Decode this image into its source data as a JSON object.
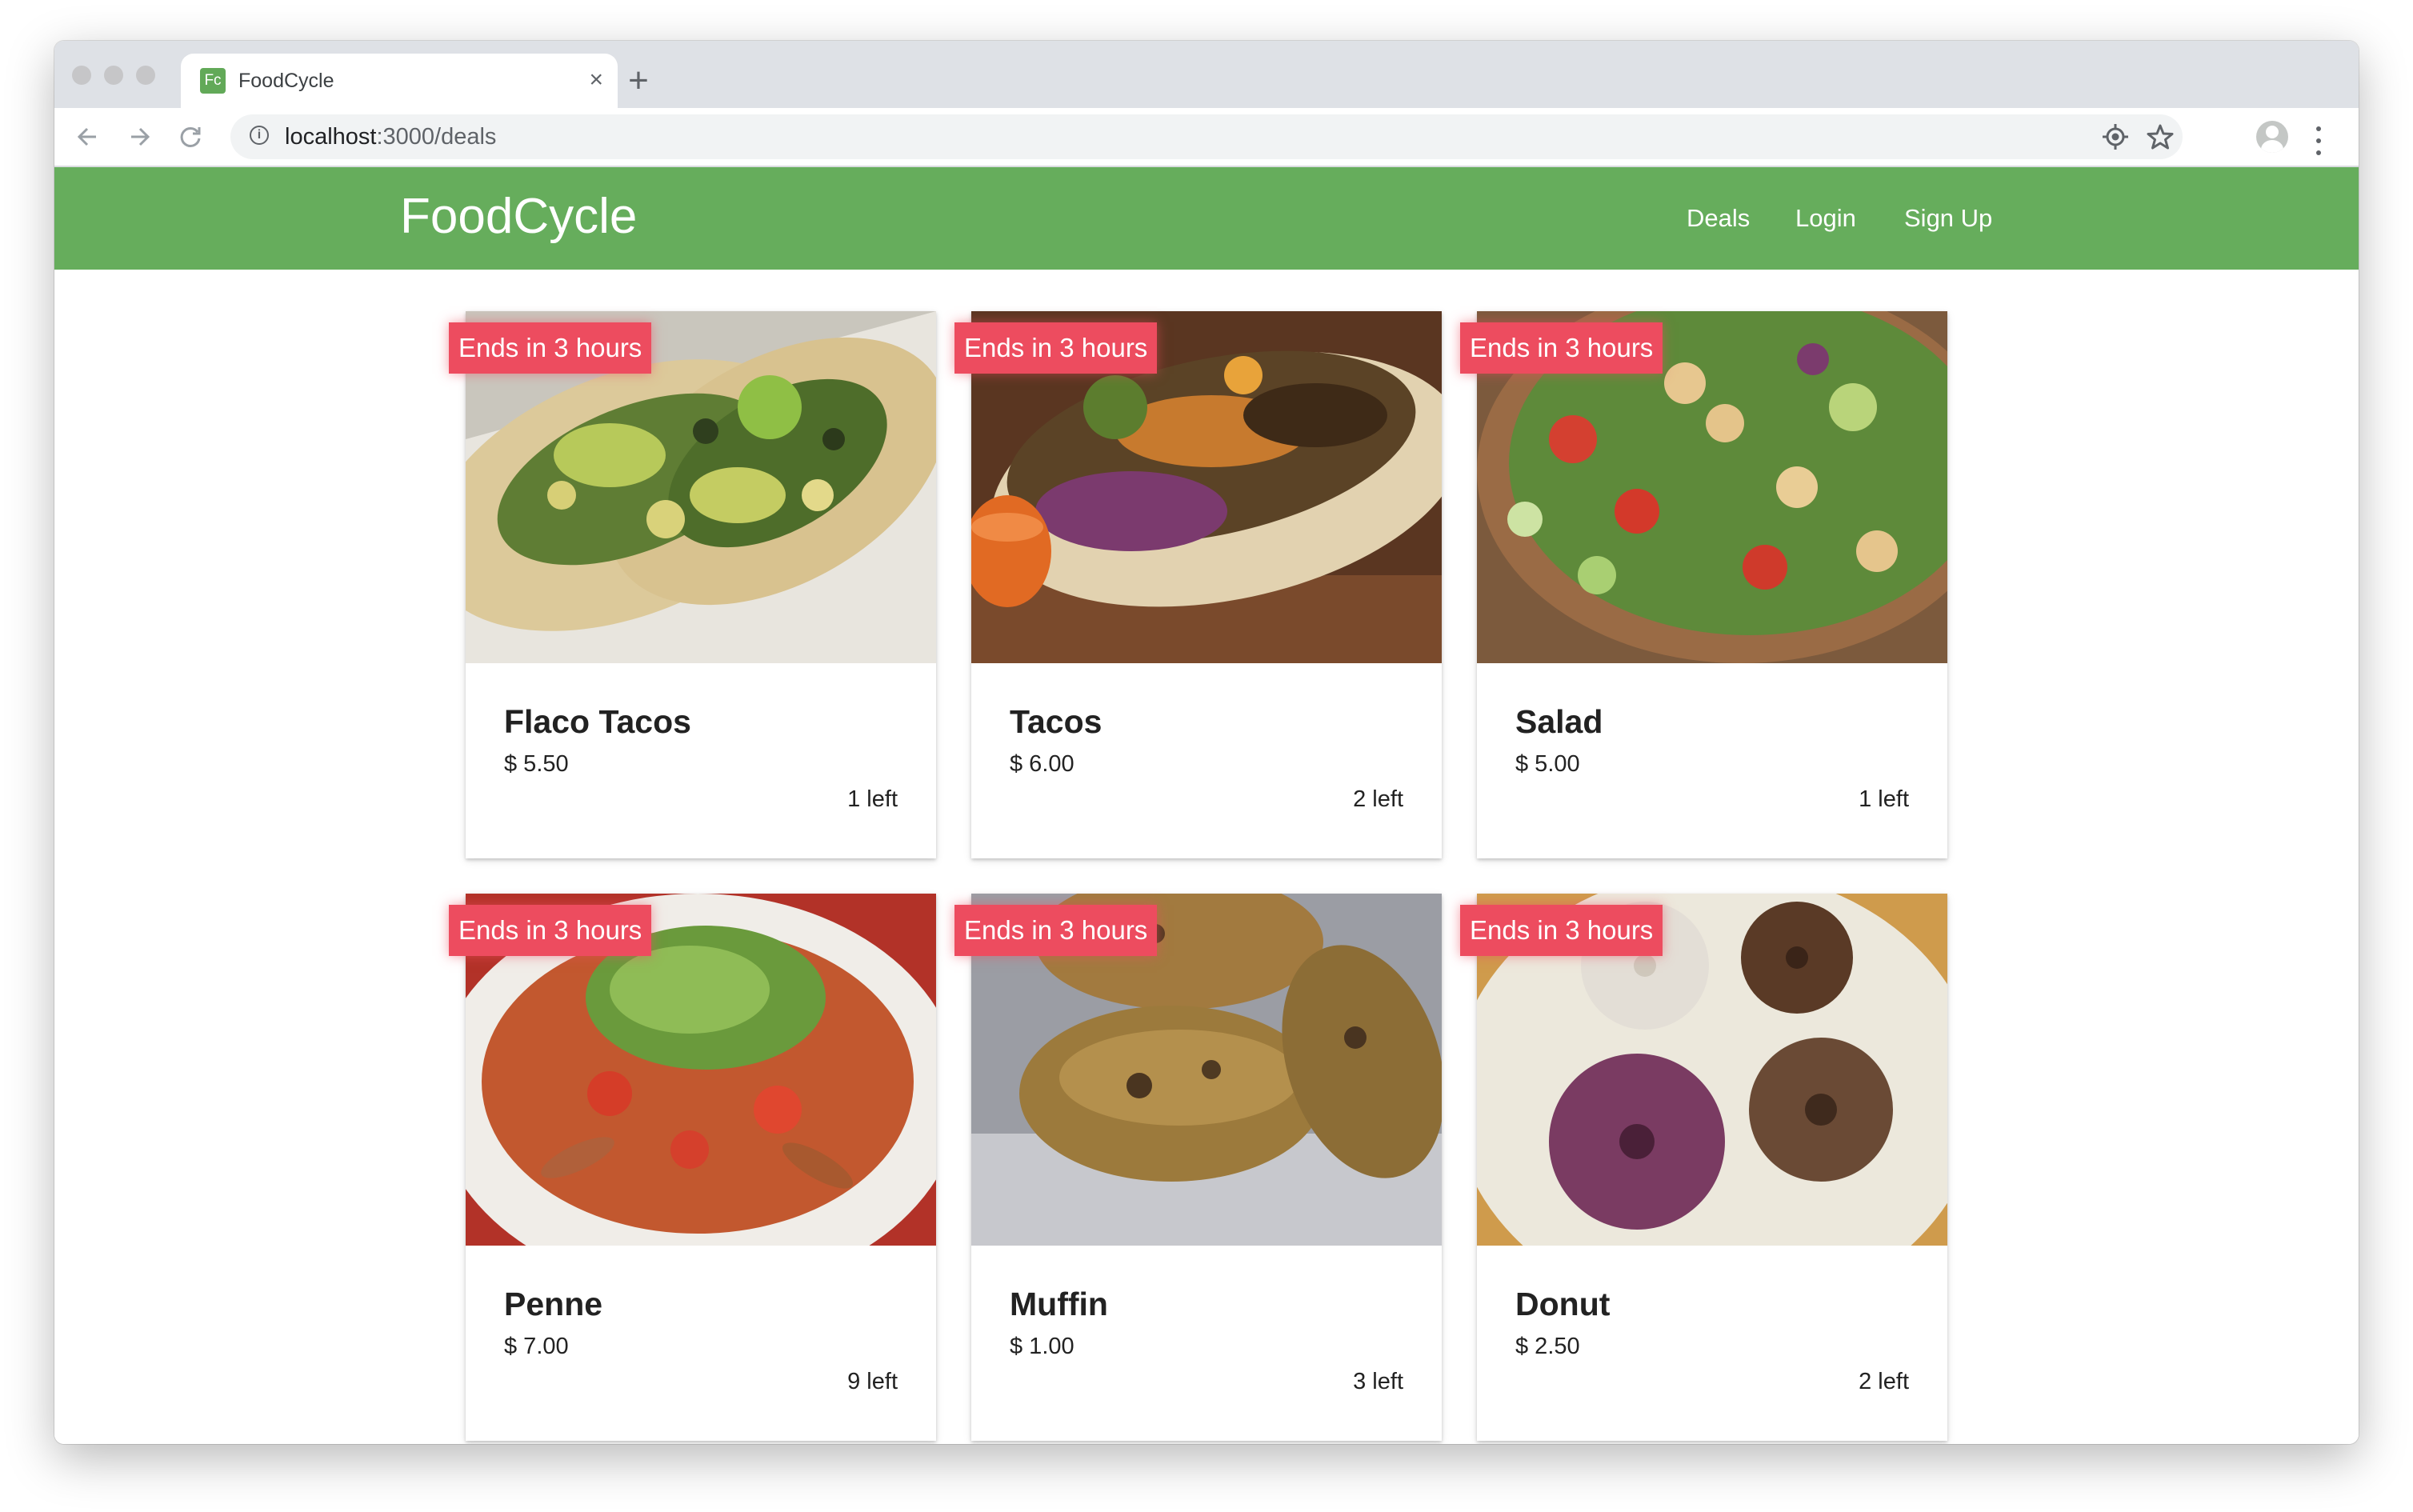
{
  "browser": {
    "tab": {
      "favicon_text": "Fc",
      "title": "FoodCycle",
      "close_label": "×"
    },
    "new_tab_label": "+",
    "url": {
      "host": "localhost",
      "path": ":3000/deals"
    }
  },
  "app": {
    "brand": "FoodCycle",
    "nav": {
      "deals": "Deals",
      "login": "Login",
      "signup": "Sign Up"
    },
    "colors": {
      "header": "#66ad5c",
      "badge": "#ed4c5f"
    }
  },
  "deals": [
    {
      "badge": "Ends in 3 hours",
      "title": "Flaco Tacos",
      "price": "$ 5.50",
      "left": "1 left",
      "image": "tacos-photo"
    },
    {
      "badge": "Ends in 3 hours",
      "title": "Tacos",
      "price": "$ 6.00",
      "left": "2 left",
      "image": "tacos-photo"
    },
    {
      "badge": "Ends in 3 hours",
      "title": "Salad",
      "price": "$ 5.00",
      "left": "1 left",
      "image": "salad-photo"
    },
    {
      "badge": "Ends in 3 hours",
      "title": "Penne",
      "price": "$ 7.00",
      "left": "9 left",
      "image": "penne-photo"
    },
    {
      "badge": "Ends in 3 hours",
      "title": "Muffin",
      "price": "$ 1.00",
      "left": "3 left",
      "image": "muffin-photo"
    },
    {
      "badge": "Ends in 3 hours",
      "title": "Donut",
      "price": "$ 2.50",
      "left": "2 left",
      "image": "donut-photo"
    }
  ]
}
